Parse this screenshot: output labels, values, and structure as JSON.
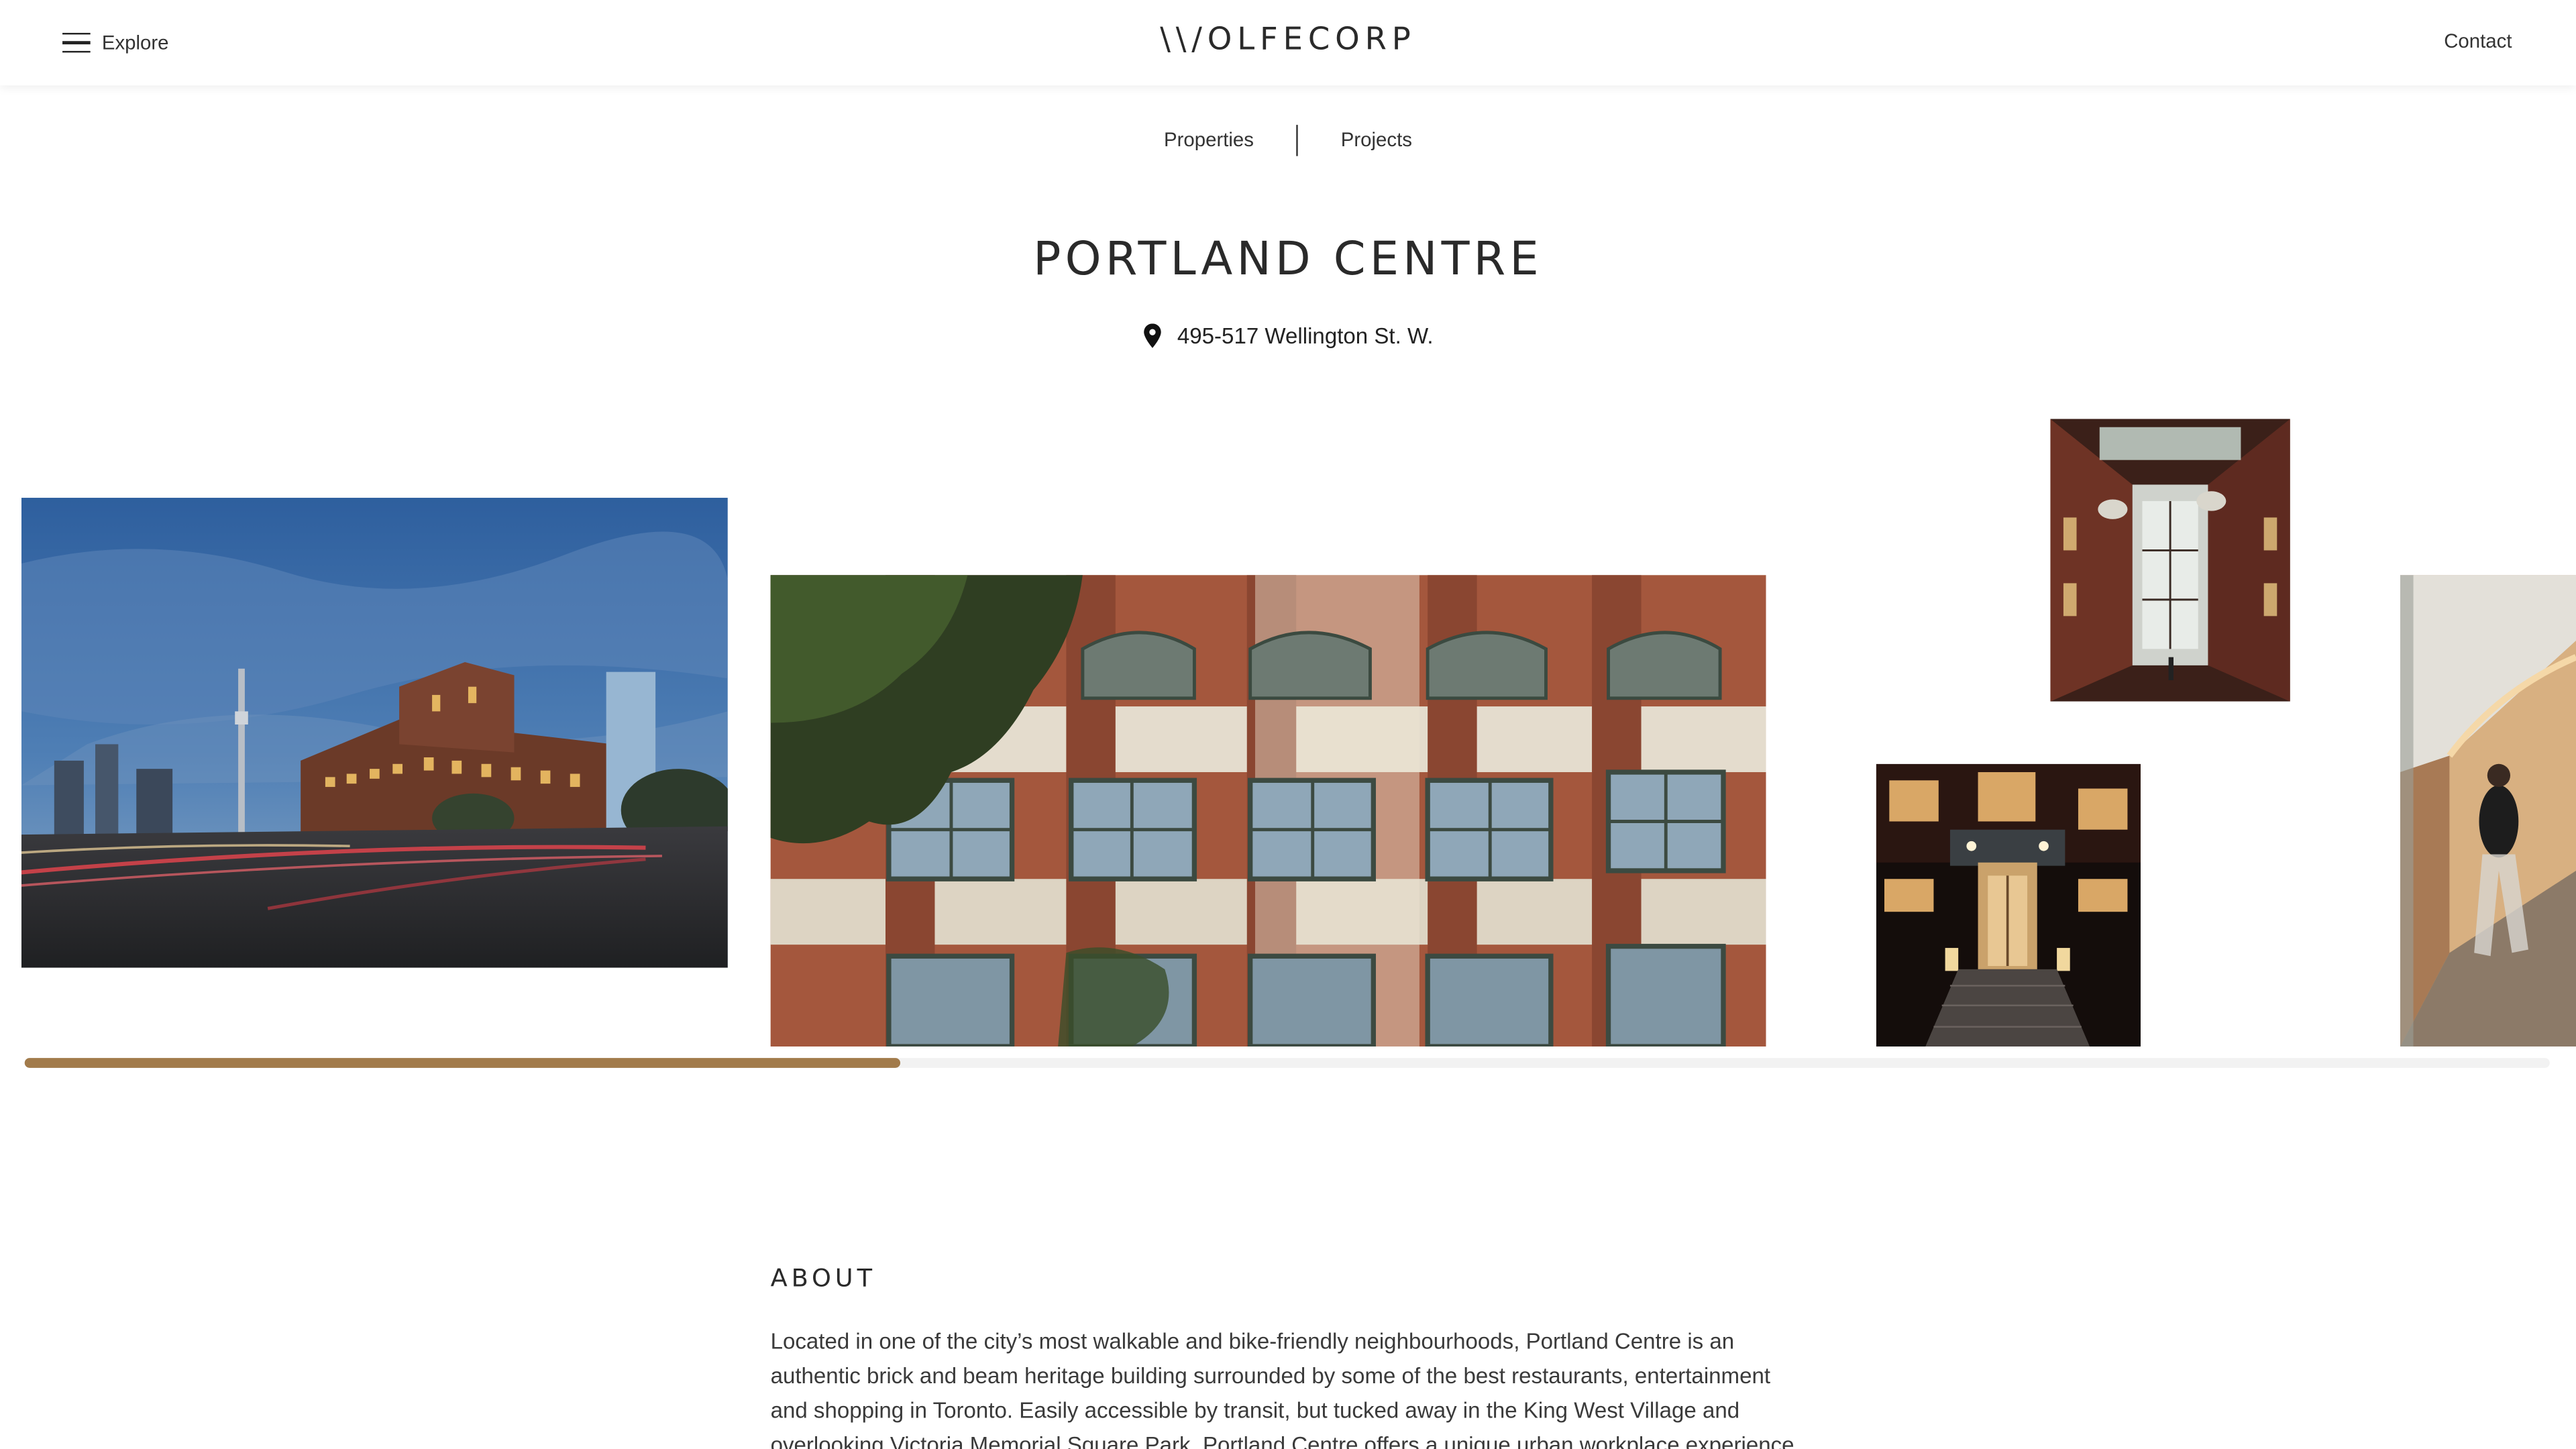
{
  "header": {
    "menu_label": "Explore",
    "logo_text": "\\\\/OLFECORP",
    "contact_label": "Contact"
  },
  "subnav": {
    "items": [
      "Properties",
      "Projects"
    ]
  },
  "property": {
    "title": "PORTLAND CENTRE",
    "address": "495-517 Wellington St. W."
  },
  "gallery": {
    "images": [
      {
        "name": "exterior-dusk-photo",
        "alt": "Portland Centre exterior at dusk with CN Tower"
      },
      {
        "name": "brick-facade-photo",
        "alt": "Brick facade with arched windows"
      },
      {
        "name": "atrium-interior-photo",
        "alt": "Interior atrium corridor"
      },
      {
        "name": "entrance-night-photo",
        "alt": "Building entrance at night"
      },
      {
        "name": "hallway-person-photo",
        "alt": "Hallway with walking person"
      }
    ],
    "scroll_progress": 0.347,
    "accent_color": "#a27b4b"
  },
  "about": {
    "heading": "ABOUT",
    "text": "Located in one of the city’s most walkable and bike-friendly neighbourhoods, Portland Centre is an authentic brick and beam heritage building surrounded by some of the best restaurants, entertainment and shopping in Toronto. Easily accessible by transit, but tucked away in the King West Village and overlooking Victoria Memorial Square Park, Portland Centre offers a unique urban workplace experience."
  },
  "icons": {
    "menu": "hamburger-icon",
    "location": "map-pin-icon"
  }
}
